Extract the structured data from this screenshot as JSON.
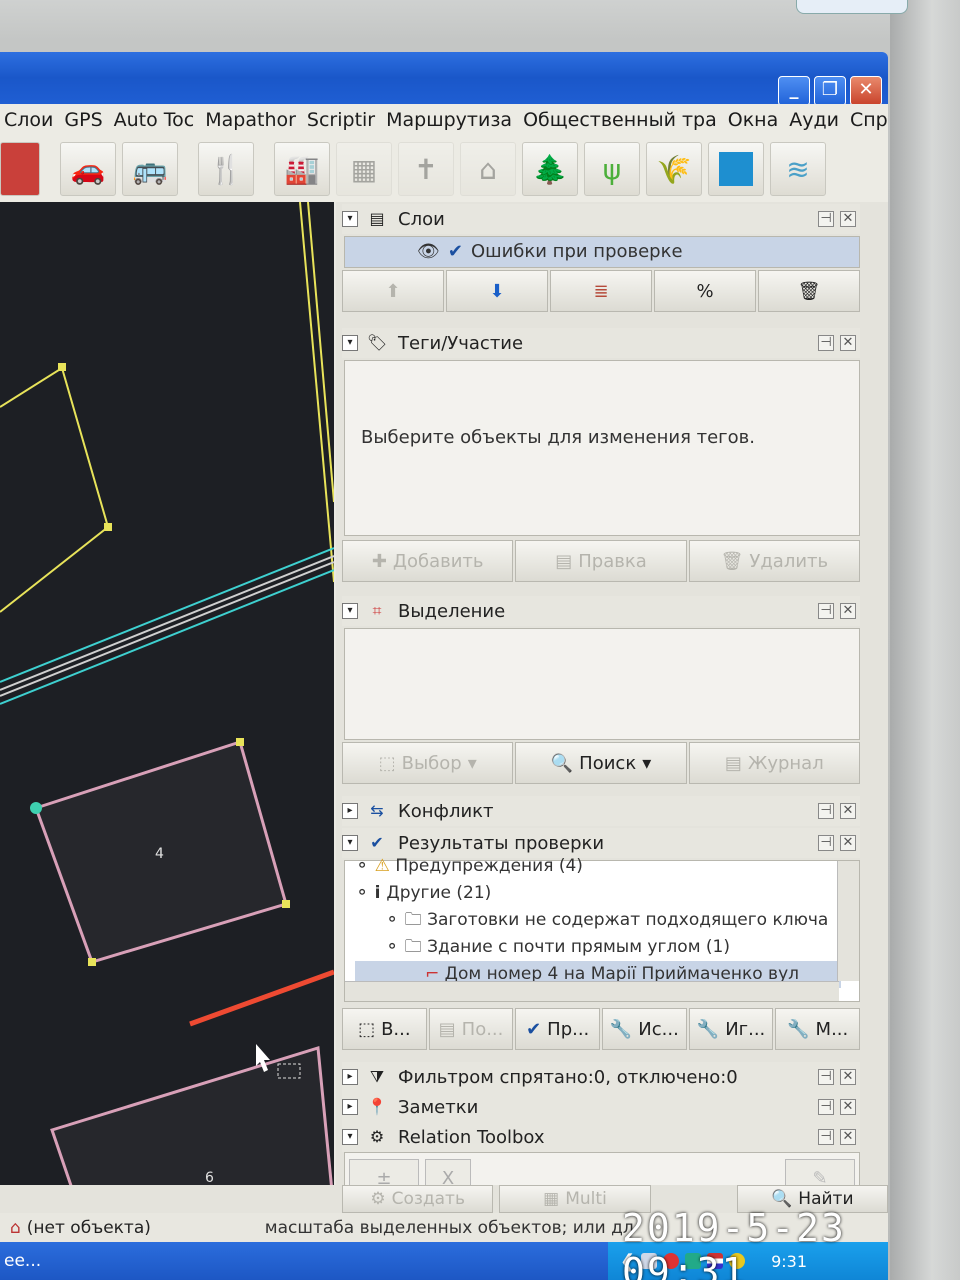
{
  "menu": [
    "Слои",
    "GPS",
    "Auto Toc",
    "Mapathor",
    "Scriptir",
    "Маршрутиза",
    "Общественный тра",
    "Окна",
    "Ауди",
    "Справ"
  ],
  "window_controls": {
    "minimize": "_",
    "maximize": "❐",
    "close": "✕"
  },
  "panels": {
    "layers": {
      "title": "Слои",
      "item": "Ошибки при проверке"
    },
    "tags": {
      "title": "Теги/Участие",
      "message": "Выберите объекты для изменения тегов.",
      "buttons": [
        "Добавить",
        "Правка",
        "Удалить"
      ]
    },
    "selection": {
      "title": "Выделение",
      "buttons": [
        "Выбор",
        "Поиск",
        "Журнал"
      ]
    },
    "conflict": {
      "title": "Конфликт"
    },
    "validation": {
      "title": "Результаты проверки",
      "tree": [
        "Предупреждения (4)",
        "Другие (21)",
        "Заготовки не содержат подходящего ключа",
        "Здание с почти прямым углом (1)",
        "Дом номер 4 на Марії Приймаченко вул"
      ],
      "buttons": [
        "В...",
        "По...",
        "Пр...",
        "Ис...",
        "Иг...",
        "М..."
      ]
    },
    "filter": {
      "title": "Фильтром спрятано:0, отключено:0"
    },
    "notes": {
      "title": "Заметки"
    },
    "relation": {
      "title": "Relation Toolbox",
      "buttons": [
        "Создать",
        "Multi",
        "Найти"
      ]
    }
  },
  "map": {
    "labels": [
      "4",
      "6"
    ]
  },
  "status": {
    "object": "(нет объекта)",
    "hint": "масштаба выделенных объектов; или дл"
  },
  "taskbar": {
    "item": "ee...",
    "clock": "9:31"
  },
  "photo_timestamp": "2019-5-23 09:31",
  "colors": {
    "titlebar": "#1f5ed3",
    "map_bg": "#1d1f24",
    "building_selected": "#d8a0b8",
    "road": "#e8e35a",
    "arrow": "#ee4a32"
  }
}
